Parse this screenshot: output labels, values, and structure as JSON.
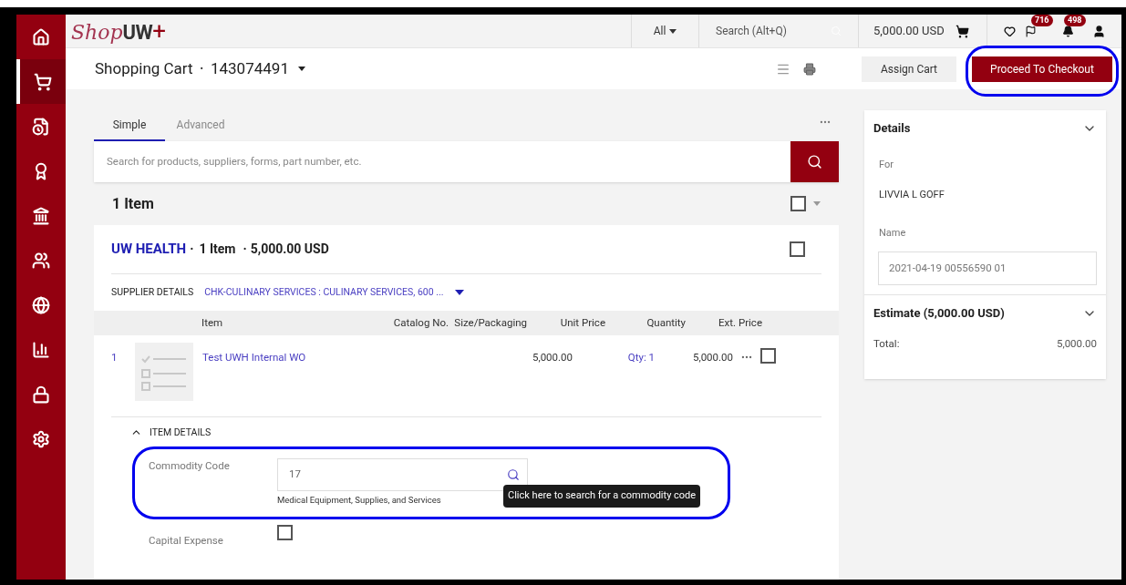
{
  "sidebar": {
    "items": [
      {
        "selected": false
      },
      {
        "selected": true
      },
      {
        "selected": false
      },
      {
        "selected": false
      },
      {
        "selected": false
      },
      {
        "selected": false
      },
      {
        "selected": false
      },
      {
        "selected": false
      },
      {
        "selected": false
      },
      {
        "selected": false
      }
    ]
  },
  "topbar": {
    "logo": {
      "script": "Shop",
      "bold": "UW",
      "plus": "+"
    },
    "scope": "All",
    "search_placeholder": "Search (Alt+Q)",
    "cart_total": "5,000.00 USD",
    "flag_count": "716",
    "notification_count": "498"
  },
  "header": {
    "title": "Shopping Cart",
    "separator": "•",
    "cart_number": "143074491",
    "assign_button": "Assign Cart",
    "checkout_button": "Proceed To Checkout"
  },
  "search_tabs": [
    {
      "label": "Simple",
      "selected": true
    },
    {
      "label": "Advanced",
      "selected": false
    }
  ],
  "search": {
    "placeholder": "Search for products, suppliers, forms, part number, etc."
  },
  "item_count": "1 Item",
  "select_all_checked": false,
  "supplier": {
    "name": "UW HEALTH",
    "separator_1": "·",
    "count": "1 Item",
    "separator_2": "·",
    "total": "5,000.00 USD",
    "checked": false,
    "details_label": "SUPPLIER DETAILS",
    "details_value": "CHK-CULINARY SERVICES : CULINARY SERVICES, 600 ..."
  },
  "table": {
    "columns": [
      "Item",
      "Catalog No.",
      "Size/Packaging",
      "Unit Price",
      "Quantity",
      "Ext. Price"
    ],
    "rows": [
      {
        "number": "1",
        "name": "Test UWH Internal WO",
        "unit_price": "5,000.00",
        "quantity": "Qty: 1",
        "ext_price": "5,000.00",
        "checked": false
      }
    ]
  },
  "item_details": {
    "label": "ITEM DETAILS",
    "expanded": true,
    "commodity_label": "Commodity Code",
    "commodity_value": "17",
    "commodity_description": "Medical Equipment, Supplies, and Services",
    "tooltip": "Click here to search for a commodity code",
    "capital_label": "Capital Expense",
    "capital_checked": false
  },
  "details_panel": {
    "title": "Details",
    "for_label": "For",
    "for_value": "LIVVIA L GOFF",
    "name_label": "Name",
    "name_value": "2021-04-19 00556590 01",
    "estimate_title": "Estimate (5,000.00 USD)",
    "total_label": "Total:",
    "total_value": "5,000.00"
  }
}
